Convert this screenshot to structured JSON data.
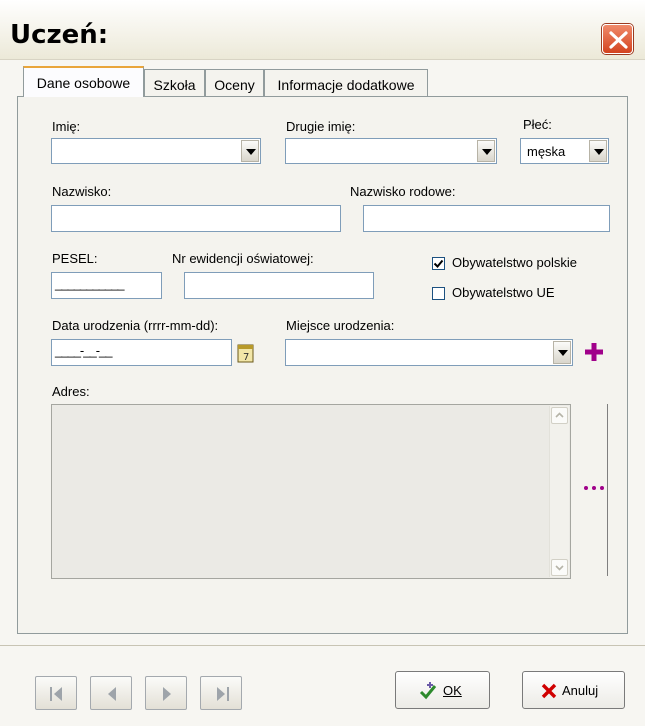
{
  "window": {
    "title": "Uczeń:"
  },
  "tabs": [
    {
      "label": "Dane osobowe",
      "active": true
    },
    {
      "label": "Szkoła"
    },
    {
      "label": "Oceny"
    },
    {
      "label": "Informacje dodatkowe"
    }
  ],
  "form": {
    "imie": {
      "label": "Imię:",
      "value": ""
    },
    "drugie_imie": {
      "label": "Drugie imię:",
      "value": ""
    },
    "plec": {
      "label": "Płeć:",
      "value": "męska"
    },
    "nazwisko": {
      "label": "Nazwisko:",
      "value": ""
    },
    "nazwisko_rodowe": {
      "label": "Nazwisko rodowe:",
      "value": ""
    },
    "pesel": {
      "label": "PESEL:",
      "value": "___________"
    },
    "nr_ewidencji": {
      "label": "Nr ewidencji oświatowej:",
      "value": ""
    },
    "obywatelstwo_polskie": {
      "label": "Obywatelstwo polskie",
      "checked": true
    },
    "obywatelstwo_ue": {
      "label": "Obywatelstwo UE",
      "checked": false
    },
    "data_urodzenia": {
      "label": "Data urodzenia (rrrr-mm-dd):",
      "value": "____-__-__"
    },
    "miejsce_urodzenia": {
      "label": "Miejsce urodzenia:",
      "value": ""
    },
    "adres": {
      "label": "Adres:",
      "value": ""
    }
  },
  "buttons": {
    "ok": "OK",
    "cancel": "Anuluj"
  },
  "icons": {
    "close": "close-icon",
    "calendar": "calendar-icon",
    "add": "plus-icon",
    "more": "ellipsis-icon",
    "first": "first-record-icon",
    "prev": "previous-record-icon",
    "next": "next-record-icon",
    "last": "last-record-icon",
    "ok": "checkmark-icon",
    "cancel": "x-icon"
  },
  "colors": {
    "accent_plus": "#a0008a",
    "close_button": "#d3431f",
    "cancel_x": "#d00000",
    "ok_check": "#2d8a2d"
  }
}
